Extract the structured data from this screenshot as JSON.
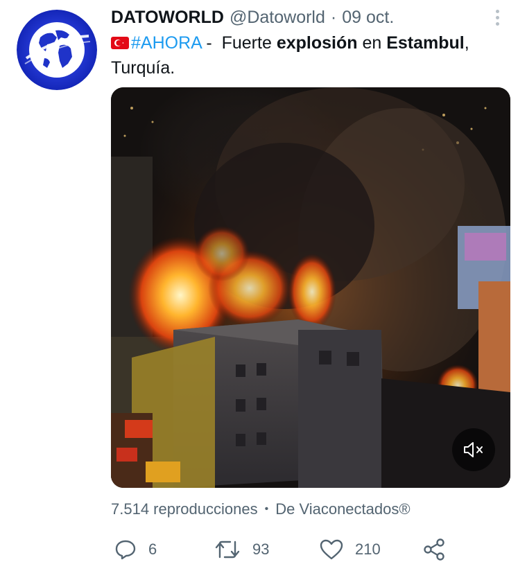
{
  "tweet": {
    "display_name": "DATOWORLD",
    "handle": "@Datoworld",
    "separator": "·",
    "date": "09 oct.",
    "text": {
      "hashtag": "#AHORA",
      "dash": " -  Fuerte ",
      "bold1": "explosión",
      "mid": " en ",
      "bold2": "Estambul",
      "tail": ", Turquía."
    },
    "flag_icon": "turkey-flag-icon"
  },
  "media": {
    "kind": "video",
    "mute_icon": "volume-muted-icon"
  },
  "stats": {
    "views": "7.514 reproducciones",
    "dot": "•",
    "source": "De Viaconectados®"
  },
  "actions": {
    "reply_count": "6",
    "retweet_count": "93",
    "like_count": "210",
    "icons": [
      "reply-icon",
      "retweet-icon",
      "like-icon",
      "share-icon"
    ]
  },
  "colors": {
    "link": "#1d9bf0",
    "secondary_text": "#536471",
    "primary_text": "#0f1419",
    "avatar_blue": "#1f33c9"
  }
}
